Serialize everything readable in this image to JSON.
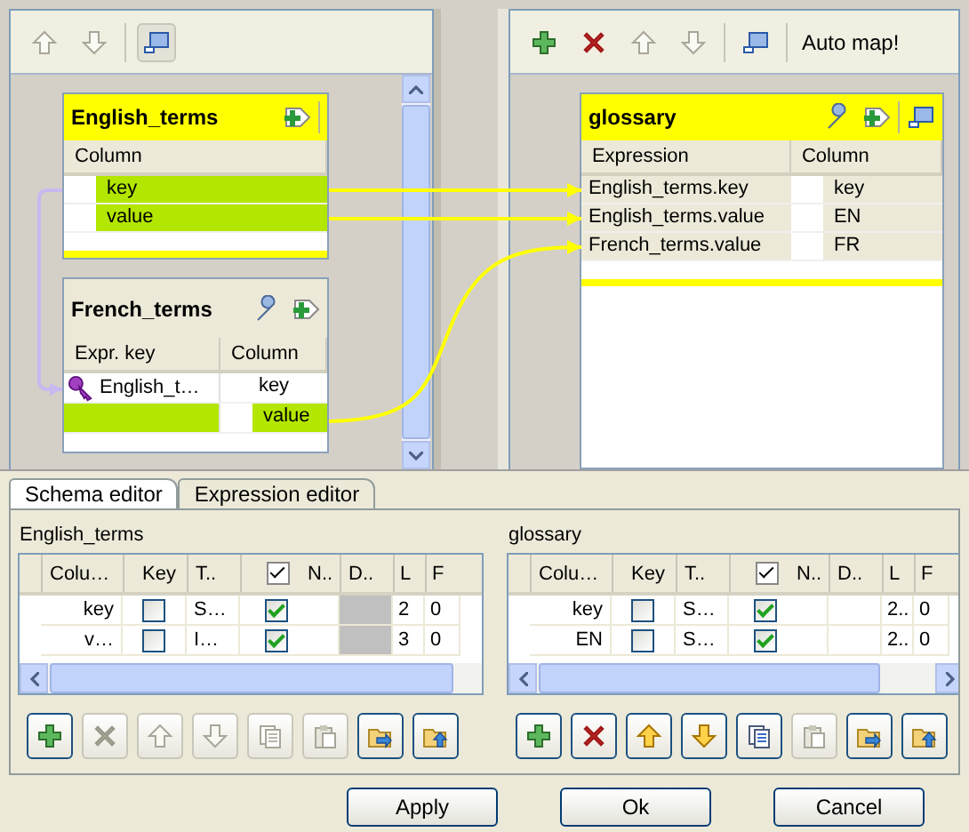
{
  "left_toolbar": [
    {
      "kind": "up",
      "disabled": true
    },
    {
      "kind": "down",
      "disabled": true
    },
    {
      "kind": "window",
      "disabled": false
    }
  ],
  "inputs": [
    {
      "kind": "main",
      "title": "English_terms",
      "headers": [
        "Column"
      ],
      "rows": [
        {
          "column": "key",
          "highlighted": true
        },
        {
          "column": "value",
          "highlighted": true
        }
      ]
    },
    {
      "kind": "lookup",
      "title": "French_terms",
      "headers": [
        "Expr. key",
        "Column"
      ],
      "rows": [
        {
          "expr": "English_t…",
          "column": "key",
          "highlighted": false
        },
        {
          "column": "value",
          "highlighted": true
        }
      ]
    }
  ],
  "right_toolbar": {
    "buttons": [
      {
        "kind": "add",
        "disabled": false
      },
      {
        "kind": "delete",
        "disabled": false
      },
      {
        "kind": "up",
        "disabled": true
      },
      {
        "kind": "down",
        "disabled": true
      },
      {
        "kind": "window",
        "disabled": false
      }
    ],
    "auto_map": "Auto map!"
  },
  "output": {
    "title": "glossary",
    "headers": [
      "Expression",
      "Column"
    ],
    "rows": [
      {
        "expression": "English_terms.key",
        "column": "key"
      },
      {
        "expression": "English_terms.value",
        "column": "EN"
      },
      {
        "expression": "French_terms.value",
        "column": "FR"
      }
    ]
  },
  "tabs": [
    {
      "label": "Schema editor",
      "selected": true
    },
    {
      "label": "Expression editor",
      "selected": false
    }
  ],
  "schemas": [
    {
      "title": "English_terms",
      "headers": [
        "Colu…",
        "Key",
        "T..",
        "N..",
        "D..",
        "L",
        "F"
      ],
      "header_checked": true,
      "rows": [
        {
          "column": "key",
          "key": false,
          "type": "S…",
          "nullable": true,
          "default_disabled": true,
          "length": "2",
          "precision": "0"
        },
        {
          "column": "v…",
          "key": false,
          "type": "I…",
          "nullable": true,
          "default_disabled": true,
          "length": "3",
          "precision": "0"
        }
      ],
      "tools": [
        {
          "kind": "add",
          "disabled": false
        },
        {
          "kind": "delete",
          "disabled": true
        },
        {
          "kind": "up",
          "disabled": true
        },
        {
          "kind": "down",
          "disabled": true
        },
        {
          "kind": "copy",
          "disabled": true
        },
        {
          "kind": "paste",
          "disabled": true
        },
        {
          "kind": "import",
          "disabled": false
        },
        {
          "kind": "export",
          "disabled": false
        }
      ]
    },
    {
      "title": "glossary",
      "headers": [
        "Colu…",
        "Key",
        "T..",
        "N..",
        "D..",
        "L",
        "F"
      ],
      "header_checked": true,
      "rows": [
        {
          "column": "key",
          "key": false,
          "type": "S…",
          "nullable": true,
          "default_disabled": false,
          "length": "2..",
          "precision": "0"
        },
        {
          "column": "EN",
          "key": false,
          "type": "S…",
          "nullable": true,
          "default_disabled": false,
          "length": "2..",
          "precision": "0"
        }
      ],
      "tools": [
        {
          "kind": "add",
          "disabled": false
        },
        {
          "kind": "delete",
          "disabled": false
        },
        {
          "kind": "up",
          "disabled": false
        },
        {
          "kind": "down",
          "disabled": false
        },
        {
          "kind": "copy",
          "disabled": false
        },
        {
          "kind": "paste",
          "disabled": true
        },
        {
          "kind": "import",
          "disabled": false
        },
        {
          "kind": "export",
          "disabled": false
        }
      ]
    }
  ],
  "buttons": [
    "Apply",
    "Ok",
    "Cancel"
  ]
}
